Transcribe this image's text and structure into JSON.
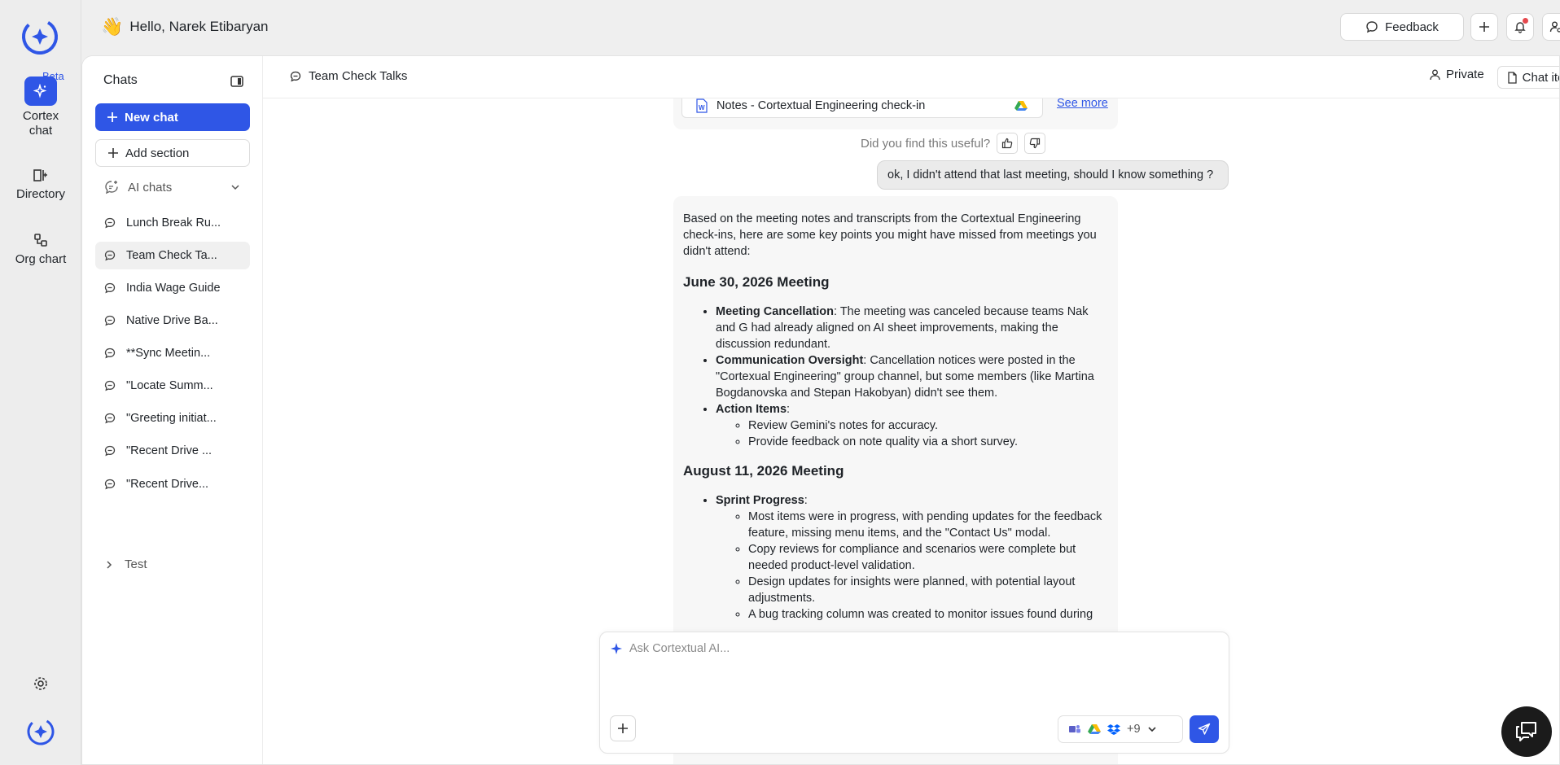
{
  "rail": {
    "beta": "Beta",
    "items": [
      {
        "label_line1": "Cortex",
        "label_line2": "chat"
      },
      {
        "label": "Directory"
      },
      {
        "label": "Org chart"
      }
    ]
  },
  "header": {
    "greeting": "Hello, Narek Etibaryan",
    "wave": "👋",
    "feedback": "Feedback"
  },
  "chats": {
    "title": "Chats",
    "new_chat": "New chat",
    "add_section": "Add section",
    "ai_chats": "AI chats",
    "items": [
      "Lunch Break Ru...",
      "Team Check Ta...",
      "India Wage Guide",
      "Native Drive Ba...",
      "**Sync Meetin...",
      "\"Locate Summ...",
      "\"Greeting initiat...",
      "\"Recent Drive ...",
      "\"Recent Drive..."
    ],
    "test_section": "Test"
  },
  "chat_header": {
    "title": "Team Check Talks",
    "private": "Private",
    "chat_items": "Chat items",
    "more": "···"
  },
  "conversation": {
    "attachment": "Notes - Cortextual Engineering check-in",
    "see_more": "See more",
    "useful_prompt": "Did you find this useful?",
    "user_message": "ok, I didn't attend that last meeting, should I know something ?",
    "answer": {
      "intro": "Based on the meeting notes and transcripts from the Cortextual Engineering check-ins, here are some key points you might have missed from meetings you didn't attend:",
      "s1_title": "June 30, 2026 Meeting",
      "s1_b1_bold": "Meeting Cancellation",
      "s1_b1_text": ": The meeting was canceled because teams Nak and G had already aligned on AI sheet improvements, making the discussion redundant.",
      "s1_b2_bold": "Communication Oversight",
      "s1_b2_text": ": Cancellation notices were posted in the \"Cortexual Engineering\" group channel, but some members (like Martina Bogdanovska and Stepan Hakobyan) didn't see them.",
      "s1_b3_bold": "Action Items",
      "s1_b3_text": ":",
      "s1_b3_sub1": "Review Gemini's notes for accuracy.",
      "s1_b3_sub2": "Provide feedback on note quality via a short survey.",
      "s2_title": "August 11, 2026 Meeting",
      "s2_b1_bold": "Sprint Progress",
      "s2_b1_text": ":",
      "s2_b1_sub1": "Most items were in progress, with pending updates for the feedback feature, missing menu items, and the \"Contact Us\" modal.",
      "s2_b1_sub2": "Copy reviews for compliance and scenarios were complete but needed product-level validation.",
      "s2_b1_sub3": "Design updates for insights were planned, with potential layout adjustments.",
      "s2_b1_sub4": "A bug tracking column was created to monitor issues found during"
    }
  },
  "composer": {
    "placeholder": "Ask Cortextual AI...",
    "sources_more": "+9"
  },
  "colors": {
    "accent": "#2f56e6",
    "notification": "#e5484d"
  }
}
